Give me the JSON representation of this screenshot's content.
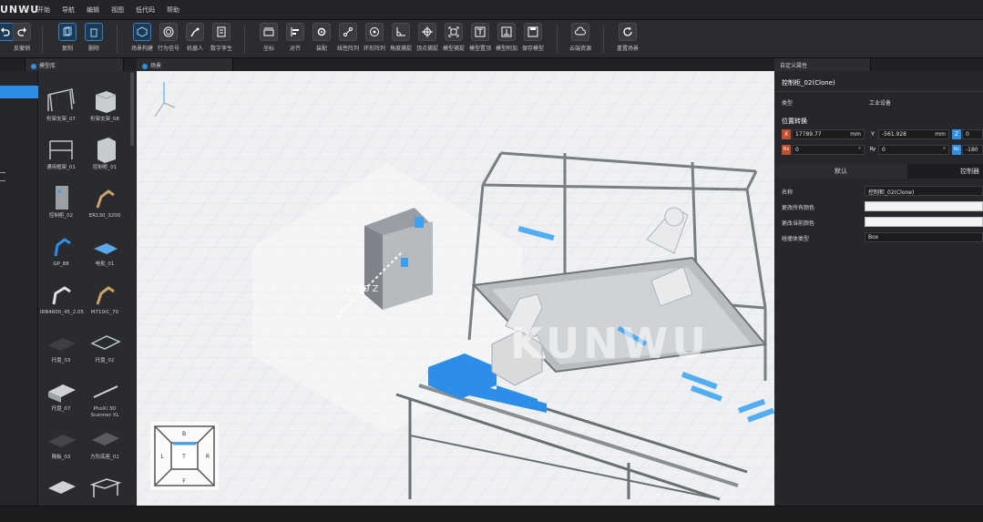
{
  "app": {
    "logo": "UNWU"
  },
  "menu": [
    "开始",
    "导航",
    "编辑",
    "视图",
    "低代码",
    "帮助"
  ],
  "toolbar": {
    "buttons": [
      {
        "label": "",
        "icon": "undo-icon"
      },
      {
        "label": "反撤销",
        "icon": "redo-icon"
      },
      {
        "label": "复制",
        "icon": "copy-icon",
        "active": true
      },
      {
        "label": "删除",
        "icon": "delete-icon",
        "active": true
      },
      {
        "label": "场景构建",
        "icon": "scene-build-icon",
        "active": true
      },
      {
        "label": "行为信号",
        "icon": "signal-icon"
      },
      {
        "label": "机器人",
        "icon": "robot-arm-icon"
      },
      {
        "label": "数字孪生",
        "icon": "digital-twin-icon"
      },
      {
        "label": "坐标",
        "icon": "coordinate-icon"
      },
      {
        "label": "对齐",
        "icon": "align-icon"
      },
      {
        "label": "装配",
        "icon": "assembly-icon"
      },
      {
        "label": "线性阵列",
        "icon": "linear-array-icon"
      },
      {
        "label": "环形阵列",
        "icon": "circular-array-icon"
      },
      {
        "label": "角度捕捉",
        "icon": "angle-snap-icon"
      },
      {
        "label": "顶点捕捉",
        "icon": "vertex-snap-icon"
      },
      {
        "label": "模型捕捉",
        "icon": "model-snap-icon"
      },
      {
        "label": "模型置顶",
        "icon": "model-top-icon"
      },
      {
        "label": "模型附加",
        "icon": "model-attach-icon"
      },
      {
        "label": "保存模型",
        "icon": "save-model-icon"
      },
      {
        "label": "云端资源",
        "icon": "cloud-icon"
      },
      {
        "label": "重置场景",
        "icon": "reset-icon"
      }
    ]
  },
  "panels": {
    "library_tab": "模型库",
    "scene_tab": "场景",
    "props_tab": "自定义属性"
  },
  "library": {
    "items": [
      "桁架支架_07",
      "桁架支架_08",
      "通用框架_01",
      "控制柜_01",
      "控制柜_02",
      "ER130_3200",
      "GP_88",
      "电批_01",
      "IRB4600_45_2.05",
      "M710iC_70",
      "托盘_03",
      "托盘_02",
      "托盘_07",
      "PhoXi 3D Scanner XL",
      "隔板_03",
      "方形底座_01",
      "",
      ""
    ]
  },
  "viewport": {
    "coord_readout": "1260 Z",
    "watermark_text": "KUNWU",
    "navcube": {
      "top": "B",
      "left": "L",
      "center": "T",
      "right": "R",
      "bottom": "F"
    }
  },
  "properties": {
    "object_name": "控制柜_02(Clone)",
    "type_label": "类型",
    "type_value": "工业设备",
    "transform_label": "位置转换",
    "x_value": "17789.77",
    "y_value": "-561.928",
    "z_value": "0",
    "rx_value": "0",
    "ry_value": "0",
    "rz_value": "-180",
    "unit_mm": "mm",
    "unit_deg": "°",
    "tab_default": "默认",
    "tab_controller": "控制器",
    "name_label": "名称",
    "name_value": "控制柜_02(Clone)",
    "color_all_label": "更改所有颜色",
    "color_current_label": "更改当前颜色",
    "collider_label": "碰撞体类型",
    "collider_value": "Box"
  },
  "colors": {
    "accent": "#2e8ee6",
    "bg": "#1e1f21",
    "viewport": "#eef0f2"
  }
}
